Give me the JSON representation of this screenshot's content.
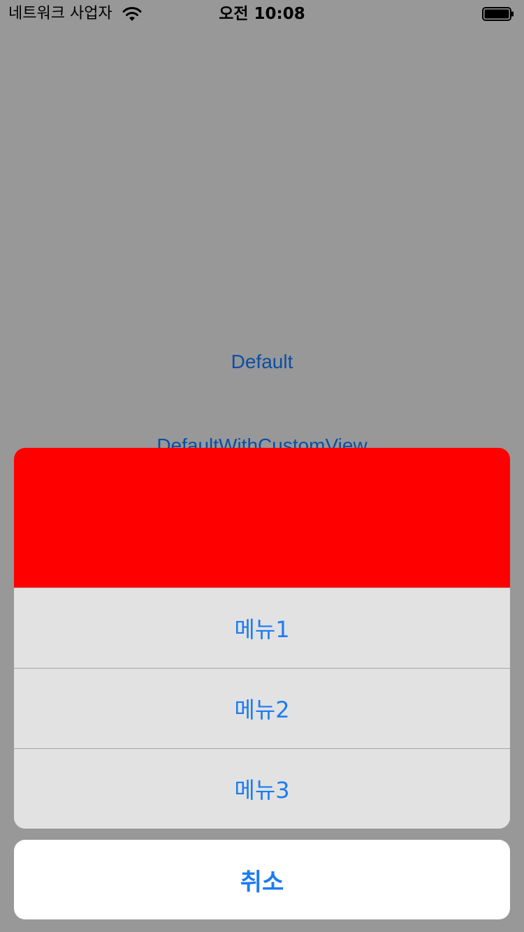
{
  "status_bar": {
    "carrier": "네트워크 사업자",
    "time": "오전 10:08",
    "wifi_icon": "wifi-icon",
    "battery_icon": "battery-icon",
    "battery_level": 1.0
  },
  "background": {
    "buttons": [
      {
        "label": "Default"
      },
      {
        "label": "DefaultWithCustomView"
      }
    ]
  },
  "action_sheet": {
    "custom_view_color": "#ff0000",
    "items": [
      {
        "label": "메뉴1"
      },
      {
        "label": "메뉴2"
      },
      {
        "label": "메뉴3"
      }
    ],
    "cancel_label": "취소",
    "accent_color": "#1a7cf2"
  }
}
